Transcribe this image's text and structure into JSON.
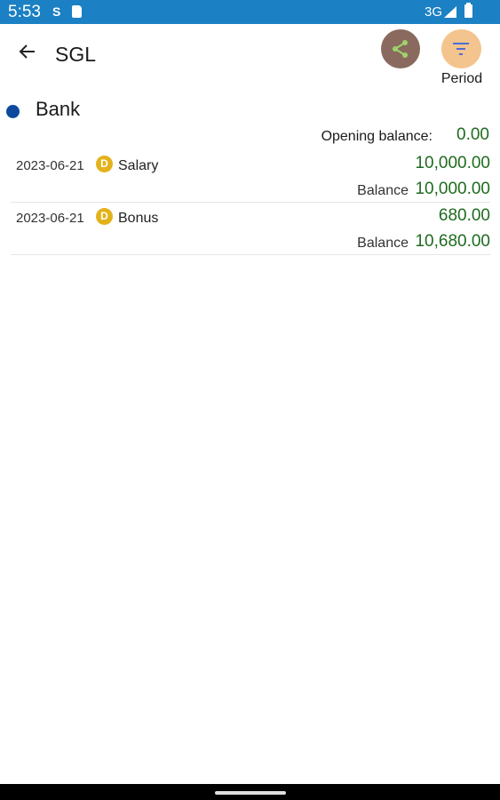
{
  "status_bar": {
    "time": "5:53",
    "sim_indicator": "S",
    "network": "3G",
    "background_color": "#1b80c4",
    "icons": [
      "sd-card-icon",
      "signal-icon",
      "battery-icon"
    ]
  },
  "header": {
    "title": "SGL",
    "period_label": "Period",
    "back_icon": "arrow-left-icon",
    "share_icon": "share-icon",
    "filter_icon": "filter-icon",
    "share_button_color": "#8a6a5e",
    "period_button_color": "#f4c48e"
  },
  "account": {
    "name": "Bank",
    "dot_color": "#0d4a9b",
    "opening_balance_label": "Opening balance:",
    "opening_balance": "0.00"
  },
  "transactions": [
    {
      "date": "2023-06-21",
      "type_badge": "D",
      "description": "Salary",
      "amount": "10,000.00",
      "balance_label": "Balance",
      "balance": "10,000.00"
    },
    {
      "date": "2023-06-21",
      "type_badge": "D",
      "description": "Bonus",
      "amount": "680.00",
      "balance_label": "Balance",
      "balance": "10,680.00"
    }
  ],
  "colors": {
    "amount_green": "#1e6b1e",
    "badge_yellow": "#e3b21b"
  }
}
